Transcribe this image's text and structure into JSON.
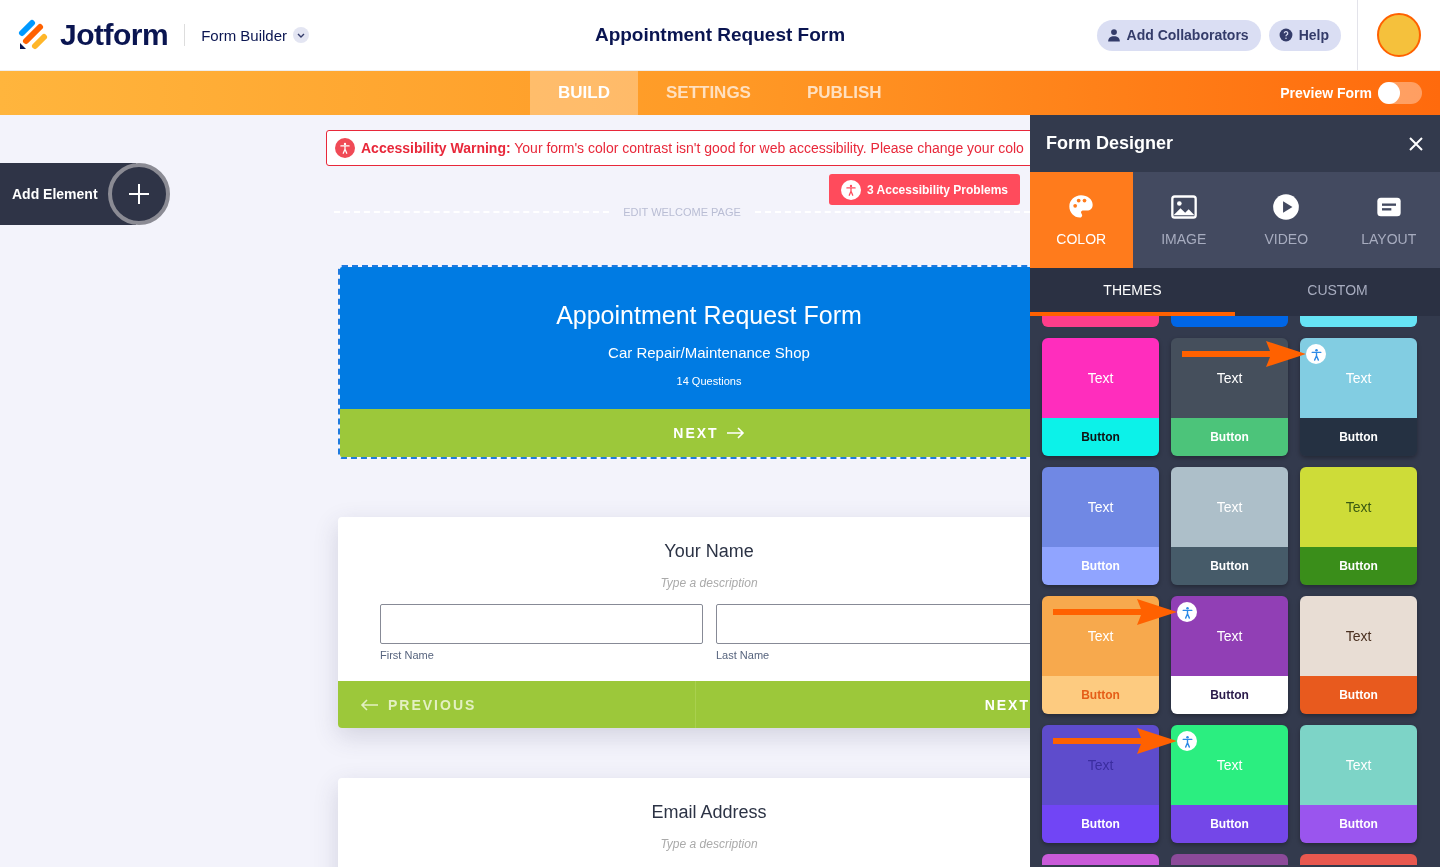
{
  "header": {
    "logo_text": "Jotform",
    "product": "Form Builder",
    "title": "Appointment Request Form",
    "buttons": [
      {
        "label": "Add Collaborators",
        "kind": "collaborators"
      },
      {
        "label": "Help",
        "kind": "help"
      }
    ]
  },
  "nav": {
    "tabs": [
      {
        "label": "BUILD",
        "selected": true
      },
      {
        "label": "SETTINGS",
        "selected": false
      },
      {
        "label": "PUBLISH",
        "selected": false
      }
    ],
    "preview": {
      "label": "Preview Form",
      "on": false
    }
  },
  "add_element": {
    "label": "Add Element"
  },
  "warning": {
    "title": "Accessibility Warning:",
    "text": "Your form's color contrast isn't good for web accessibility. Please change your colo"
  },
  "problems_button": "3 Accessibility Problems",
  "welcome_divider": "EDIT WELCOME PAGE",
  "welcome_card": {
    "title": "Appointment Request Form",
    "subtitle": "Car Repair/Maintenance Shop",
    "count": "14 Questions",
    "next": "NEXT"
  },
  "questions": [
    {
      "title": "Your Name",
      "description": "Type a description",
      "fields": [
        {
          "label": "First Name"
        },
        {
          "label": "Last Name"
        }
      ],
      "previous": "PREVIOUS",
      "next": "NEXT"
    },
    {
      "title": "Email Address",
      "description": "Type a description"
    }
  ],
  "designer": {
    "title": "Form Designer",
    "tabs": [
      {
        "label": "COLOR",
        "kind": "palette",
        "selected": true
      },
      {
        "label": "IMAGE",
        "kind": "image",
        "selected": false
      },
      {
        "label": "VIDEO",
        "kind": "video",
        "selected": false
      },
      {
        "label": "LAYOUT",
        "kind": "layout",
        "selected": false
      }
    ],
    "subtabs": [
      {
        "label": "THEMES",
        "selected": true
      },
      {
        "label": "CUSTOM",
        "selected": false
      }
    ],
    "themes": [
      {
        "kind": "bottom_edge",
        "color": "#ff3d8b"
      },
      {
        "kind": "bottom_edge",
        "color": "#0066e6"
      },
      {
        "kind": "bottom_edge",
        "color": "#66e3f5"
      },
      {
        "kind": "full",
        "top": {
          "color": "#ff2dbd"
        },
        "top_text": {
          "label": "Text",
          "color": "#ffffff"
        },
        "button": {
          "color": "#0cf2e9"
        },
        "button_text": {
          "label": "Button",
          "color": "#111111"
        },
        "accessibility_issue": false,
        "annotated": false
      },
      {
        "kind": "full",
        "top": {
          "color": "#454f5c"
        },
        "top_text": {
          "label": "Text",
          "color": "#ffffff"
        },
        "button": {
          "color": "#4cc47a"
        },
        "button_text": {
          "label": "Button",
          "color": "#ffffff"
        },
        "accessibility_issue": false,
        "annotated": false
      },
      {
        "kind": "full",
        "top": {
          "color": "#82cde2"
        },
        "top_text": {
          "label": "Text",
          "color": "#ffffff"
        },
        "button": {
          "color": "#253142"
        },
        "button_text": {
          "label": "Button",
          "color": "#ffffff"
        },
        "accessibility_issue": true,
        "annotated": true
      },
      {
        "kind": "full",
        "top": {
          "color": "#7088e4"
        },
        "top_text": {
          "label": "Text",
          "color": "#ffffff"
        },
        "button": {
          "color": "#90a4ff"
        },
        "button_text": {
          "label": "Button",
          "color": "#ffffff"
        },
        "accessibility_issue": false,
        "annotated": false
      },
      {
        "kind": "full",
        "top": {
          "color": "#adbfc9"
        },
        "top_text": {
          "label": "Text",
          "color": "#ffffff"
        },
        "button": {
          "color": "#465b69"
        },
        "button_text": {
          "label": "Button",
          "color": "#ffffff"
        },
        "accessibility_issue": false,
        "annotated": false
      },
      {
        "kind": "full",
        "top": {
          "color": "#cedc38"
        },
        "top_text": {
          "label": "Text",
          "color": "#3a5a12"
        },
        "button": {
          "color": "#3a8e1a"
        },
        "button_text": {
          "label": "Button",
          "color": "#ffffff"
        },
        "accessibility_issue": false,
        "annotated": false
      },
      {
        "kind": "full",
        "top": {
          "color": "#f7a94d"
        },
        "top_text": {
          "label": "Text",
          "color": "#ffffff"
        },
        "button": {
          "color": "#fdcb80"
        },
        "button_text": {
          "label": "Button",
          "color": "#e55e18"
        },
        "accessibility_issue": false,
        "annotated": false
      },
      {
        "kind": "full",
        "top": {
          "color": "#913fb5"
        },
        "top_text": {
          "label": "Text",
          "color": "#ffffff"
        },
        "button": {
          "color": "#ffffff"
        },
        "button_text": {
          "label": "Button",
          "color": "#2a1a4a"
        },
        "accessibility_issue": true,
        "annotated": true
      },
      {
        "kind": "full",
        "top": {
          "color": "#e8ddd4"
        },
        "top_text": {
          "label": "Text",
          "color": "#4a3020"
        },
        "button": {
          "color": "#e85a1e"
        },
        "button_text": {
          "label": "Button",
          "color": "#ffffff"
        },
        "accessibility_issue": false,
        "annotated": false
      },
      {
        "kind": "full",
        "top": {
          "color": "#5e4ccc"
        },
        "top_text": {
          "label": "Text",
          "color": "#3b2da0"
        },
        "button": {
          "color": "#7145f5"
        },
        "button_text": {
          "label": "Button",
          "color": "#ffffff"
        },
        "accessibility_issue": false,
        "annotated": false
      },
      {
        "kind": "full",
        "top": {
          "color": "#2bee80"
        },
        "top_text": {
          "label": "Text",
          "color": "#ffffff"
        },
        "button": {
          "color": "#7447e8"
        },
        "button_text": {
          "label": "Button",
          "color": "#ffffff"
        },
        "accessibility_issue": true,
        "annotated": true
      },
      {
        "kind": "full",
        "top": {
          "color": "#7dd4c7"
        },
        "top_text": {
          "label": "Text",
          "color": "#ffffff"
        },
        "button": {
          "color": "#9a55ee"
        },
        "button_text": {
          "label": "Button",
          "color": "#ffffff"
        },
        "accessibility_issue": false,
        "annotated": false
      },
      {
        "kind": "top_edge",
        "color": "#c95ad9"
      },
      {
        "kind": "top_edge",
        "color": "#8c4a9a"
      },
      {
        "kind": "top_edge",
        "color": "#e8584f"
      }
    ]
  }
}
